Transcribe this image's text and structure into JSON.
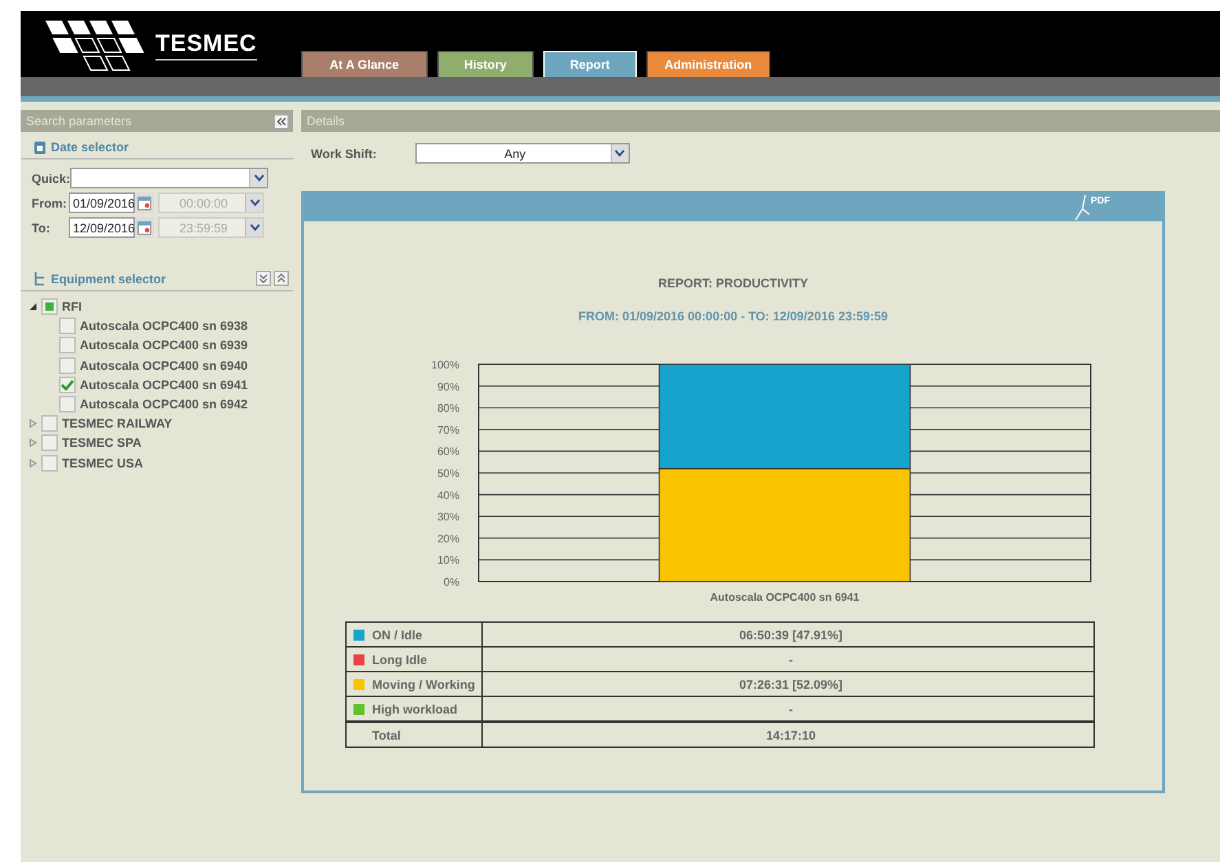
{
  "header": {
    "logo": "TESMEC",
    "tabs": [
      {
        "label": "At A Glance",
        "color": "#a97f6c",
        "selected": false
      },
      {
        "label": "History",
        "color": "#8fae6e",
        "selected": false
      },
      {
        "label": "Report",
        "color": "#6ea6bf",
        "selected": true
      },
      {
        "label": "Administration",
        "color": "#e98a3d",
        "selected": false
      }
    ]
  },
  "sidebar": {
    "title": "Search parameters",
    "date_selector": {
      "title": "Date selector",
      "quick_label": "Quick:",
      "rows": [
        {
          "label": "From:",
          "date": "01/09/2016",
          "time": "00:00:00"
        },
        {
          "label": "To:",
          "date": "12/09/2016",
          "time": "23:59:59"
        }
      ]
    },
    "equipment_selector": {
      "title": "Equipment selector",
      "tree": [
        {
          "label": "RFI",
          "checked": false,
          "partial": true,
          "expanded": true,
          "children": [
            {
              "label": "Autoscala OCPC400 sn 6938",
              "checked": false
            },
            {
              "label": "Autoscala OCPC400 sn 6939",
              "checked": false
            },
            {
              "label": "Autoscala OCPC400 sn 6940",
              "checked": false
            },
            {
              "label": "Autoscala OCPC400 sn 6941",
              "checked": true
            },
            {
              "label": "Autoscala OCPC400 sn 6942",
              "checked": false
            }
          ]
        },
        {
          "label": "TESMEC RAILWAY",
          "checked": false,
          "partial": false,
          "expanded": false
        },
        {
          "label": "TESMEC SPA",
          "checked": false,
          "partial": false,
          "expanded": false
        },
        {
          "label": "TESMEC USA",
          "checked": false,
          "partial": false,
          "expanded": false
        }
      ]
    }
  },
  "details": {
    "title": "Details",
    "work_shift": {
      "label": "Work Shift:",
      "value": "Any"
    },
    "report": {
      "pdf_label": "PDF",
      "title": "REPORT: PRODUCTIVITY",
      "range": "FROM: 01/09/2016 00:00:00 - TO: 12/09/2016 23:59:59",
      "chart_data": {
        "type": "bar",
        "stacked": true,
        "categories": [
          "Autoscala OCPC400 sn 6941"
        ],
        "series": [
          {
            "color": "#f9c300",
            "values": [
              52
            ]
          },
          {
            "color": "#16a4cc",
            "values": [
              48
            ]
          }
        ],
        "ylim": [
          0,
          100
        ],
        "grid": true,
        "yticks": [
          {
            "value": 0,
            "label": "0%"
          },
          {
            "value": 10,
            "label": "10%"
          },
          {
            "value": 20,
            "label": "20%"
          },
          {
            "value": 30,
            "label": "30%"
          },
          {
            "value": 40,
            "label": "40%"
          },
          {
            "value": 50,
            "label": "50%"
          },
          {
            "value": 60,
            "label": "60%"
          },
          {
            "value": 70,
            "label": "70%"
          },
          {
            "value": 80,
            "label": "80%"
          },
          {
            "value": 90,
            "label": "90%"
          },
          {
            "value": 100,
            "label": "100%"
          }
        ]
      },
      "legend": [
        {
          "kind": "state",
          "label": "ON / Idle",
          "color": "#16a4cc",
          "value": "06:50:39 [47.91%]"
        },
        {
          "kind": "state",
          "label": "Long Idle",
          "color": "#e8434b",
          "value": "-"
        },
        {
          "kind": "state",
          "label": "Moving / Working",
          "color": "#f9c300",
          "value": "07:26:31 [52.09%]"
        },
        {
          "kind": "state",
          "label": "High workload",
          "color": "#5fc22a",
          "value": "-"
        },
        {
          "kind": "total",
          "label": "Total",
          "value": "14:17:10"
        }
      ]
    }
  }
}
